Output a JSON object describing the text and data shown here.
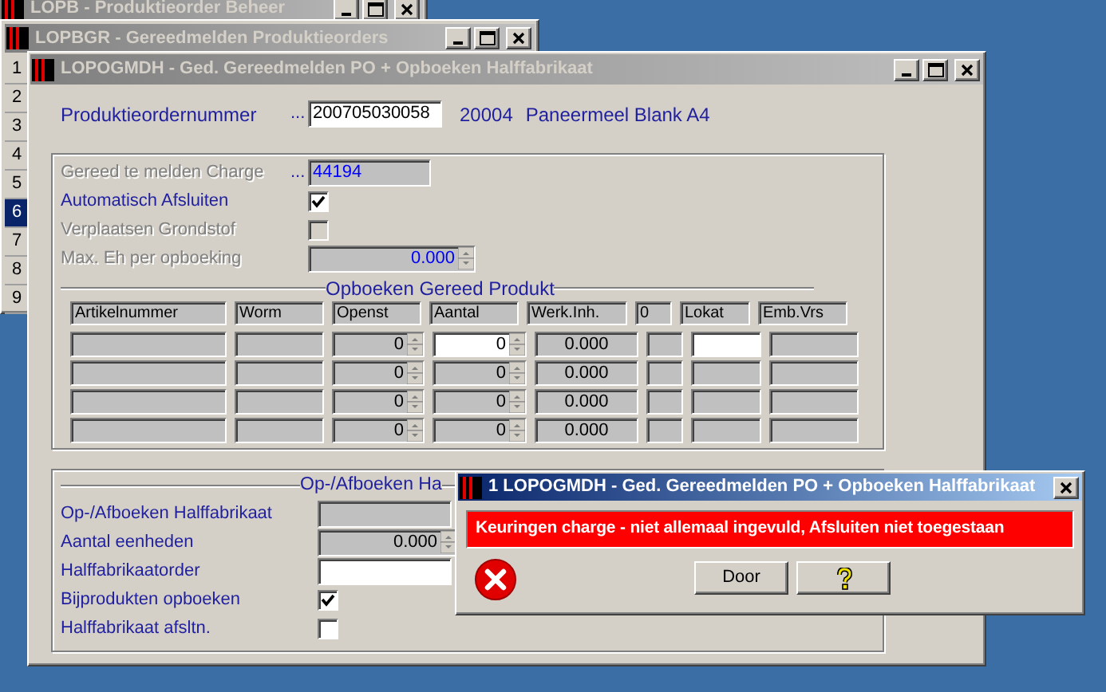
{
  "desktop": {
    "windows": [
      {
        "title": "LOPB - Produktieorder Beheer",
        "active": false
      },
      {
        "title": "LOPBGR - Gereedmelden Produktieorders",
        "active": false,
        "row_numbers": [
          {
            "label": "1",
            "selected": false
          },
          {
            "label": "2",
            "selected": false
          },
          {
            "label": "3",
            "selected": false
          },
          {
            "label": "4",
            "selected": false
          },
          {
            "label": "5",
            "selected": false
          },
          {
            "label": "6",
            "selected": true
          },
          {
            "label": "7",
            "selected": false
          },
          {
            "label": "8",
            "selected": false
          },
          {
            "label": "9",
            "selected": false
          }
        ]
      }
    ]
  },
  "main_window": {
    "title": "LOPOGMDH - Ged. Gereedmelden PO + Opboeken Halffabrikaat",
    "active": false,
    "order": {
      "label": "Produktieordernummer",
      "prefix": "...",
      "value": "200705030058",
      "article_code": "20004",
      "article_name": "Paneermeel Blank A4"
    },
    "section1": {
      "fields": [
        {
          "kind": "field",
          "label": "Gereed te melden Charge",
          "prefix": "...",
          "value": "44194",
          "disabled": true,
          "editable": false
        },
        {
          "kind": "checkbox",
          "label": "Automatisch Afsluiten",
          "checked": true,
          "disabled": false
        },
        {
          "kind": "checkbox",
          "label": "Verplaatsen Grondstof",
          "checked": false,
          "disabled": true
        },
        {
          "kind": "spinner",
          "label": "Max. Eh per opboeking",
          "value": "0.000",
          "disabled": true,
          "editable": false
        }
      ],
      "table": {
        "title": "Opboeken Gereed Produkt",
        "columns": [
          "Artikelnummer",
          "Worm",
          "Openst",
          "Aantal",
          "Werk.Inh.",
          "0",
          "Lokat",
          "Emb.Vrs"
        ],
        "rows": [
          {
            "openst": "0",
            "aantal": "0",
            "werk_inh": "0.000",
            "active": true
          },
          {
            "openst": "0",
            "aantal": "0",
            "werk_inh": "0.000",
            "active": false
          },
          {
            "openst": "0",
            "aantal": "0",
            "werk_inh": "0.000",
            "active": false
          },
          {
            "openst": "0",
            "aantal": "0",
            "werk_inh": "0.000",
            "active": false
          }
        ]
      }
    },
    "section2": {
      "title": "Op-/Afboeken Ha",
      "fields": [
        {
          "kind": "field",
          "label": "Op-/Afboeken Halffabrikaat",
          "disabled": false,
          "editable": false
        },
        {
          "kind": "spinner",
          "label": "Aantal eenheden",
          "value": "0.000",
          "disabled": false,
          "editable": false
        },
        {
          "kind": "field",
          "label": "Halffabrikaatorder",
          "disabled": false,
          "editable": true
        },
        {
          "kind": "checkbox",
          "label": "Bijprodukten opboeken",
          "checked": true,
          "disabled": false
        },
        {
          "kind": "checkbox",
          "label": "Halffabrikaat afsltn.",
          "checked": false,
          "disabled": false
        }
      ]
    }
  },
  "dialog": {
    "title": "1 LOPOGMDH - Ged. Gereedmelden PO + Opboeken Halffabrikaat",
    "active": true,
    "message": "Keuringen charge - niet allemaal ingevuld, Afsluiten niet toegestaan",
    "buttons": [
      {
        "kind": "text",
        "label": "Door"
      },
      {
        "kind": "help"
      }
    ]
  }
}
